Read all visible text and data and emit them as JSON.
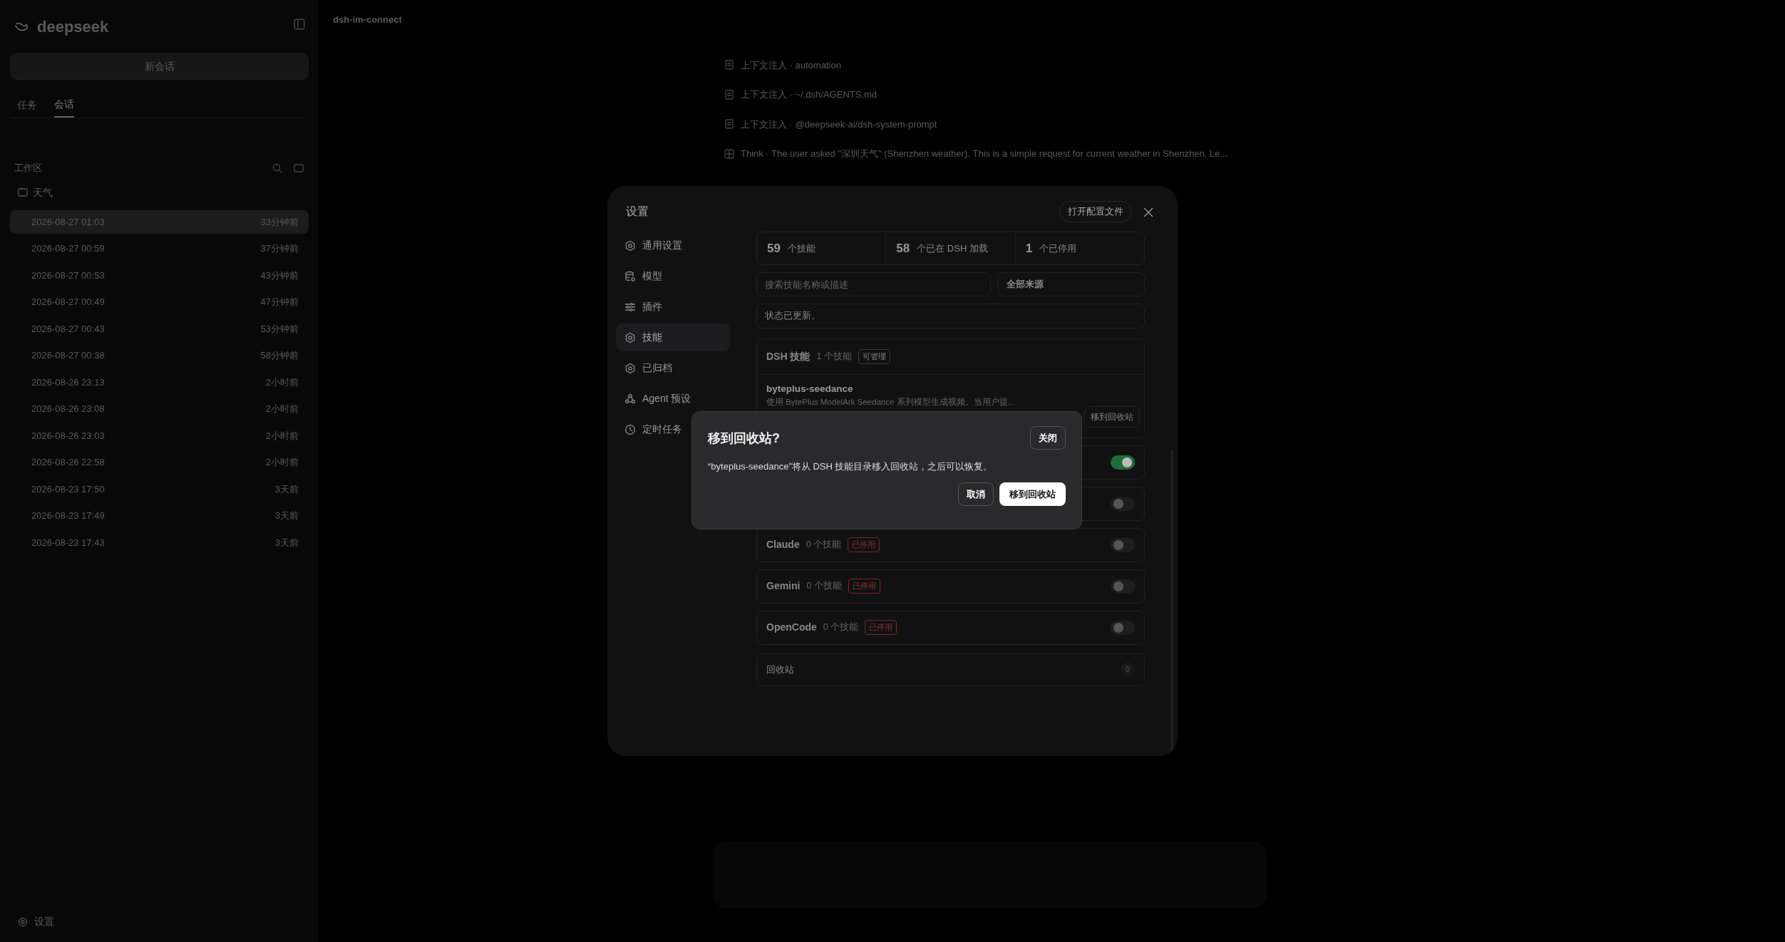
{
  "sidebar": {
    "brand": "deepseek",
    "new_chat": "新会话",
    "tabs": [
      {
        "label": "任务",
        "selected": false
      },
      {
        "label": "会话",
        "selected": true
      }
    ],
    "workspace_label": "工作区",
    "group": "天气",
    "sessions": [
      {
        "date": "2026-08-27 01:03",
        "ago": "33分钟前",
        "selected": true
      },
      {
        "date": "2026-08-27 00:59",
        "ago": "37分钟前",
        "selected": false
      },
      {
        "date": "2026-08-27 00:53",
        "ago": "43分钟前",
        "selected": false
      },
      {
        "date": "2026-08-27 00:49",
        "ago": "47分钟前",
        "selected": false
      },
      {
        "date": "2026-08-27 00:43",
        "ago": "53分钟前",
        "selected": false
      },
      {
        "date": "2026-08-27 00:38",
        "ago": "58分钟前",
        "selected": false
      },
      {
        "date": "2026-08-26 23:13",
        "ago": "2小时前",
        "selected": false
      },
      {
        "date": "2026-08-26 23:08",
        "ago": "2小时前",
        "selected": false
      },
      {
        "date": "2026-08-26 23:03",
        "ago": "2小时前",
        "selected": false
      },
      {
        "date": "2026-08-26 22:58",
        "ago": "2小时前",
        "selected": false
      },
      {
        "date": "2026-08-23 17:50",
        "ago": "3天前",
        "selected": false
      },
      {
        "date": "2026-08-23 17:49",
        "ago": "3天前",
        "selected": false
      },
      {
        "date": "2026-08-23 17:43",
        "ago": "3天前",
        "selected": false
      }
    ],
    "settings": "设置"
  },
  "header": {
    "title": "dsh-im-connect"
  },
  "chat": {
    "lines": [
      {
        "kind": "context",
        "label": "上下文注入 ·",
        "text": "automation"
      },
      {
        "kind": "context",
        "label": "上下文注入 ·",
        "text": "~/.dsh/AGENTS.md"
      },
      {
        "kind": "context",
        "label": "上下文注入 ·",
        "text": "@deepseek-ai/dsh-system-prompt"
      },
      {
        "kind": "think",
        "label": "Think ·",
        "text": "The user asked \"深圳天气\" (Shenzhen weather). This is a simple request for current weather in Shenzhen. Le..."
      }
    ]
  },
  "settings": {
    "title": "设置",
    "open_config": "打开配置文件",
    "nav": [
      {
        "label": "通用设置",
        "selected": false
      },
      {
        "label": "模型",
        "selected": false
      },
      {
        "label": "插件",
        "selected": false
      },
      {
        "label": "技能",
        "selected": true
      },
      {
        "label": "已归档",
        "selected": false
      },
      {
        "label": "Agent 预设",
        "selected": false
      },
      {
        "label": "定时任务",
        "selected": false
      }
    ],
    "stats": [
      {
        "value": "59",
        "label": "个技能"
      },
      {
        "value": "58",
        "label": "个已在 DSH 加载"
      },
      {
        "value": "1",
        "label": "个已停用"
      }
    ],
    "search": {
      "placeholder": "搜索技能名称或描述"
    },
    "source_filter": "全部来源",
    "status": "状态已更新。",
    "dsh": {
      "title": "DSH 技能",
      "count": "1 个技能",
      "badge": "可管理",
      "skills": [
        {
          "name": "byteplus-seedance",
          "description": "使用 BytePlus ModelArk Seedance 系列模型生成视频。当用户提...",
          "action": "移到回收站"
        }
      ]
    },
    "sources": [
      {
        "on": true
      },
      {
        "on": false
      },
      {
        "name": "Claude",
        "count": "0 个技能",
        "badge": "已停用",
        "on": false
      },
      {
        "name": "Gemini",
        "count": "0 个技能",
        "badge": "已停用",
        "on": false
      },
      {
        "name": "OpenCode",
        "count": "0 个技能",
        "badge": "已停用",
        "on": false
      }
    ],
    "trash": {
      "label": "回收站",
      "count": "0"
    }
  },
  "dialog": {
    "title": "移到回收站?",
    "close": "关闭",
    "message": "“byteplus-seedance”将从 DSH 技能目录移入回收站，之后可以恢复。",
    "cancel": "取消",
    "confirm": "移到回收站"
  }
}
